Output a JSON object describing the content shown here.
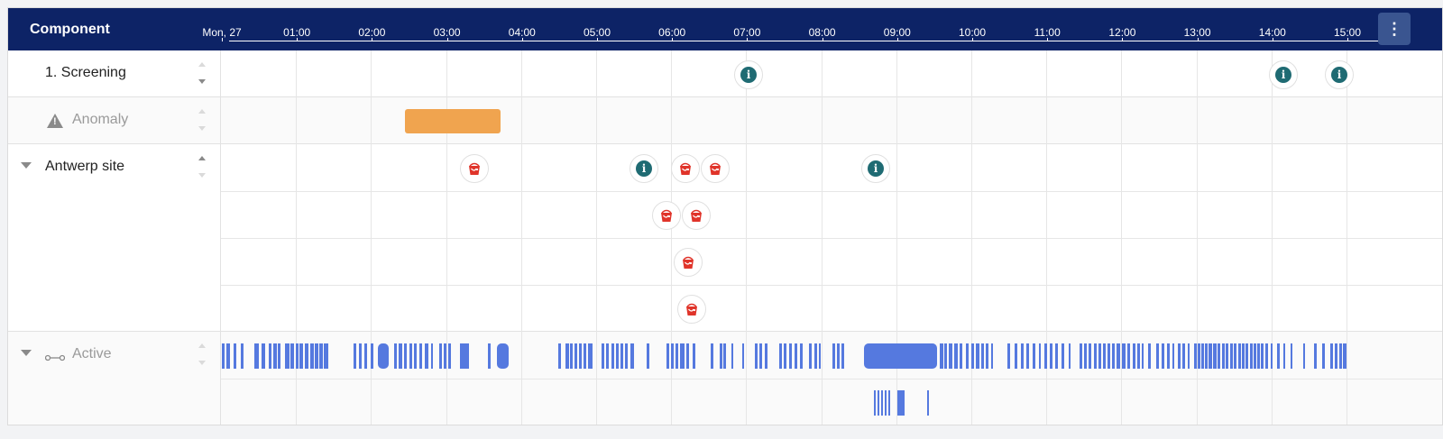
{
  "header": {
    "title": "Component",
    "menu_icon": "more-vertical-icon"
  },
  "timeline": {
    "ticks": [
      "Mon, 27",
      "01:00",
      "02:00",
      "03:00",
      "04:00",
      "05:00",
      "06:00",
      "07:00",
      "08:00",
      "09:00",
      "10:00",
      "11:00",
      "12:00",
      "13:00",
      "14:00",
      "15:00"
    ]
  },
  "rows": {
    "screening": {
      "label": "1. Screening"
    },
    "anomaly": {
      "label": "Anomaly",
      "icon": "warning-icon"
    },
    "antwerp": {
      "label": "Antwerp site"
    },
    "active": {
      "label": "Active",
      "icon": "link-icon"
    }
  },
  "colors": {
    "header_bg": "#0d2366",
    "info": "#1f6b73",
    "bucket": "#e0342a",
    "anomaly": "#f0a44f",
    "active": "#5579df"
  }
}
